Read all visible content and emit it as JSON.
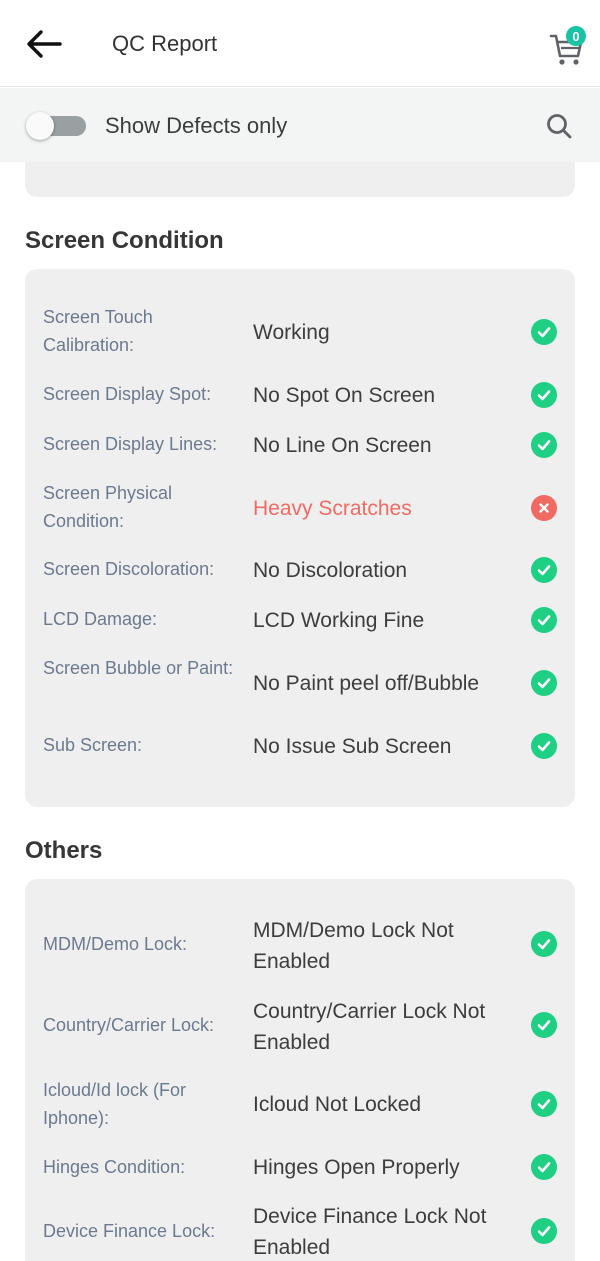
{
  "header": {
    "title": "QC Report",
    "back_icon": "arrow-left-icon",
    "cart_icon": "cart-icon",
    "cart_count": "0",
    "accent_color": "#19c3a4"
  },
  "filter": {
    "toggle_label": "Show Defects only",
    "toggle_on": false,
    "search_icon": "search-icon"
  },
  "sections": [
    {
      "title": "Screen Condition",
      "rows": [
        {
          "label": "Screen Touch Calibration:",
          "value": "Working",
          "status": "ok"
        },
        {
          "label": "Screen Display Spot:",
          "value": "No Spot On Screen",
          "status": "ok"
        },
        {
          "label": "Screen Display Lines:",
          "value": "No Line On Screen",
          "status": "ok"
        },
        {
          "label": "Screen Physical Condition:",
          "value": "Heavy Scratches",
          "status": "defect"
        },
        {
          "label": "Screen Discoloration:",
          "value": "No Discoloration",
          "status": "ok"
        },
        {
          "label": "LCD Damage:",
          "value": "LCD Working Fine",
          "status": "ok"
        },
        {
          "label": "Screen Bubble or Paint:",
          "value": "No Paint peel off/Bubble",
          "status": "ok"
        },
        {
          "label": "Sub Screen:",
          "value": "No Issue Sub Screen",
          "status": "ok"
        }
      ]
    },
    {
      "title": "Others",
      "rows": [
        {
          "label": "MDM/Demo Lock:",
          "value": "MDM/Demo Lock Not Enabled",
          "status": "ok"
        },
        {
          "label": "Country/Carrier Lock:",
          "value": "Country/Carrier Lock Not Enabled",
          "status": "ok"
        },
        {
          "label": "Icloud/Id lock (For Iphone):",
          "value": "Icloud Not Locked",
          "status": "ok"
        },
        {
          "label": "Hinges Condition:",
          "value": "Hinges Open Properly",
          "status": "ok"
        },
        {
          "label": "Device Finance Lock:",
          "value": "Device Finance Lock Not Enabled",
          "status": "ok"
        }
      ]
    }
  ],
  "status_colors": {
    "ok": "#1ecf84",
    "defect": "#f06a63"
  }
}
